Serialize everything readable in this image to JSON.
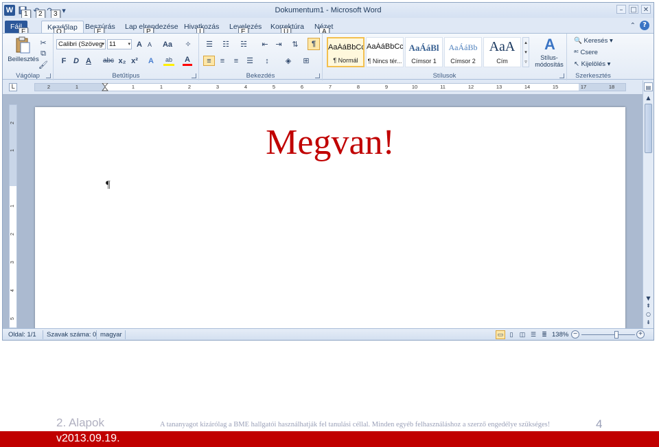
{
  "window": {
    "title": "Dokumentum1 - Microsoft Word",
    "controls": {
      "minimize": "–",
      "maximize": "□",
      "close": "✕"
    }
  },
  "qat": {
    "app_icon": "W",
    "keytips": [
      "1",
      "2",
      "3"
    ],
    "icons": [
      "word-icon",
      "save-icon",
      "undo-icon",
      "redo-icon",
      "customize-icon"
    ]
  },
  "tabs": [
    {
      "label": "Fájl",
      "keytip": "F"
    },
    {
      "label": "Kezdőlap",
      "keytip": "O"
    },
    {
      "label": "Beszúrás",
      "keytip": "E"
    },
    {
      "label": "Lap elrendezése",
      "keytip": "P"
    },
    {
      "label": "Hivatkozás",
      "keytip": "I"
    },
    {
      "label": "Levelezés",
      "keytip": "E"
    },
    {
      "label": "Korrektúra",
      "keytip": "Ü"
    },
    {
      "label": "Nézet",
      "keytip": "A"
    }
  ],
  "ribbon": {
    "groups": {
      "clipboard": "Vágólap",
      "font": "Betűtípus",
      "paragraph": "Bekezdés",
      "styles": "Stílusok",
      "editing": "Szerkesztés"
    },
    "paste_label": "Beillesztés",
    "font_name": "Calibri (Szöveg",
    "font_size": "11",
    "bold": "F",
    "italic": "D",
    "underline": "A",
    "strike": "abc",
    "subscript": "x₂",
    "superscript": "x²",
    "grow": "A",
    "shrink": "A",
    "change_case": "Aa",
    "highlight": "ab",
    "font_color": "A",
    "styles": [
      {
        "sample": "AaÁáBbCc",
        "name": "¶ Normál",
        "selected": true
      },
      {
        "sample": "AaÁáBbCc",
        "name": "¶ Nincs tér...",
        "selected": false
      },
      {
        "sample": "AaÁáBl",
        "name": "Címsor 1",
        "selected": false
      },
      {
        "sample": "AaÁáBb",
        "name": "Címsor 2",
        "selected": false
      },
      {
        "sample": "AaA",
        "name": "Cím",
        "selected": false
      }
    ],
    "change_styles": "Stílus-\nmódosítás",
    "find": "Keresés",
    "replace": "Csere",
    "select": "Kijelölés"
  },
  "document": {
    "text": "Megvan!",
    "mark": "¶"
  },
  "ruler": {
    "ticks": [
      "2",
      "1",
      "1",
      "1",
      "2",
      "3",
      "4",
      "5",
      "6",
      "7",
      "8",
      "9",
      "10",
      "11",
      "12",
      "13",
      "14",
      "15",
      "17",
      "18"
    ],
    "vticks": [
      "2",
      "1",
      "1",
      "2",
      "3",
      "4",
      "5"
    ],
    "tab_selector": "L"
  },
  "status": {
    "page": "Oldal: 1/1",
    "words": "Szavak száma: 0",
    "language": "magyar",
    "zoom": "138%",
    "zoom_level": 0.66
  },
  "footer": {
    "title": "2. Alapok",
    "notice": "A tananyagot kizárólag a BME hallgatói használhatják fel tanulási céllal. Minden egyéb felhasználáshoz a szerző engedélye szükséges!",
    "page_number": "4",
    "version": "v2013.09.19."
  },
  "colors": {
    "accent": "#2b579a",
    "doc_text": "#c00000",
    "band": "#c00000"
  }
}
